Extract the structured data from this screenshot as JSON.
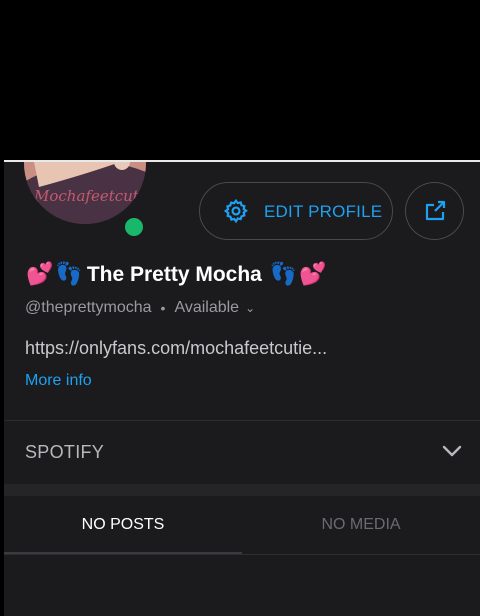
{
  "profile": {
    "avatar_watermark": "Mochafeetcutie",
    "edit_button": "EDIT PROFILE",
    "name": "The Pretty Mocha",
    "name_emoji_left": [
      "💕",
      "👣"
    ],
    "name_emoji_right": [
      "👣",
      "💕"
    ],
    "handle": "@theprettymocha",
    "separator": "•",
    "status": "Available",
    "status_chevron": "⌄",
    "link": "https://onlyfans.com/mochafeetcutie...",
    "more_info": "More info"
  },
  "sections": {
    "spotify": "SPOTIFY"
  },
  "tabs": [
    {
      "label": "NO POSTS"
    },
    {
      "label": "NO MEDIA"
    }
  ],
  "colors": {
    "accent": "#1da1f2",
    "online": "#19b76a",
    "background": "#1b1b1d"
  },
  "icons": [
    "settings-icon",
    "share-icon",
    "chevron-down-icon"
  ]
}
